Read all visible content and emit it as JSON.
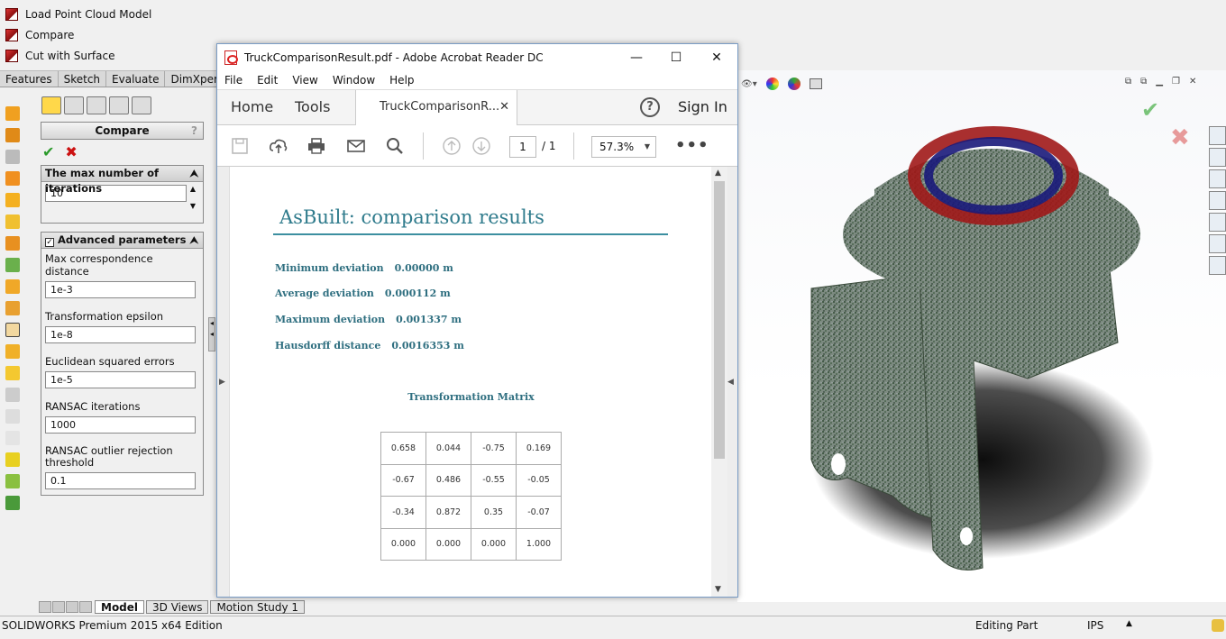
{
  "sw": {
    "commands": [
      "Load Point Cloud Model",
      "Compare",
      "Cut with Surface"
    ],
    "tabs": [
      "Features",
      "Sketch",
      "Evaluate",
      "DimXpert"
    ],
    "pm": {
      "title": "Compare",
      "help": "?",
      "ok": "✔",
      "cancel": "✖",
      "iterations_group": "The max number of iterations",
      "iterations_value": "10",
      "advanced_group": "Advanced parameters",
      "fields": [
        {
          "label": "Max correspondence distance",
          "value": "1e-3"
        },
        {
          "label": "Transformation epsilon",
          "value": "1e-8"
        },
        {
          "label": "Euclidean squared errors",
          "value": "1e-5"
        },
        {
          "label": "RANSAC iterations",
          "value": "1000"
        },
        {
          "label": "RANSAC outlier rejection threshold",
          "value": "0.1"
        }
      ]
    },
    "bottom_tabs": [
      "Model",
      "3D Views",
      "Motion Study 1"
    ],
    "status": {
      "edition": "SOLIDWORKS Premium 2015 x64 Edition",
      "mode": "Editing Part",
      "units": "IPS"
    }
  },
  "acrobat": {
    "window_title": "TruckComparisonResult.pdf - Adobe Acrobat Reader DC",
    "menu": [
      "File",
      "Edit",
      "View",
      "Window",
      "Help"
    ],
    "nav": {
      "home": "Home",
      "tools": "Tools",
      "doc_tab": "TruckComparisonR...",
      "sign_in": "Sign In"
    },
    "toolbar": {
      "page_current": "1",
      "page_total": "/ 1",
      "zoom": "57.3%"
    },
    "pdf": {
      "title": "AsBuilt: comparison results",
      "stats": [
        {
          "label": "Minimum deviation",
          "value": "0.00000 m"
        },
        {
          "label": "Average deviation",
          "value": "0.000112 m"
        },
        {
          "label": "Maximum deviation",
          "value": "0.001337 m"
        },
        {
          "label": "Hausdorff  distance",
          "value": "0.0016353 m"
        }
      ],
      "matrix_title": "Transformation Matrix",
      "matrix": [
        [
          "0.658",
          "0.044",
          "-0.75",
          "0.169"
        ],
        [
          "-0.67",
          "0.486",
          "-0.55",
          "-0.05"
        ],
        [
          "-0.34",
          "0.872",
          "0.35",
          "-0.07"
        ],
        [
          "0.000",
          "0.000",
          "0.000",
          "1.000"
        ]
      ]
    }
  },
  "colors": {
    "accent_teal": "#2f7b8c",
    "ok_green": "#2a9a2a",
    "cancel_red": "#c11111"
  }
}
